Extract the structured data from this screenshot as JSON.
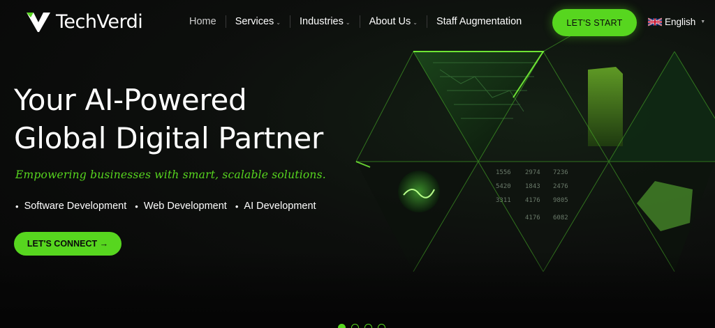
{
  "brand": {
    "name": "TechVerdi",
    "accent_color": "#57d61f"
  },
  "nav": {
    "items": [
      {
        "label": "Home",
        "has_dropdown": false
      },
      {
        "label": "Services",
        "has_dropdown": true
      },
      {
        "label": "Industries",
        "has_dropdown": true
      },
      {
        "label": "About Us",
        "has_dropdown": true
      },
      {
        "label": "Staff Augmentation",
        "has_dropdown": false
      }
    ],
    "cta_label": "LET'S START",
    "language": {
      "label": "English",
      "flag_icon": "uk-flag-icon"
    }
  },
  "hero": {
    "headline_line1": "Your AI-Powered",
    "headline_line2": "Global Digital Partner",
    "tagline": "Empowering businesses with smart, scalable solutions.",
    "services": [
      "Software Development",
      "Web Development",
      "AI Development"
    ],
    "cta_label": "LET'S CONNECT →"
  },
  "slider": {
    "slides": 4,
    "active_index": 0
  }
}
